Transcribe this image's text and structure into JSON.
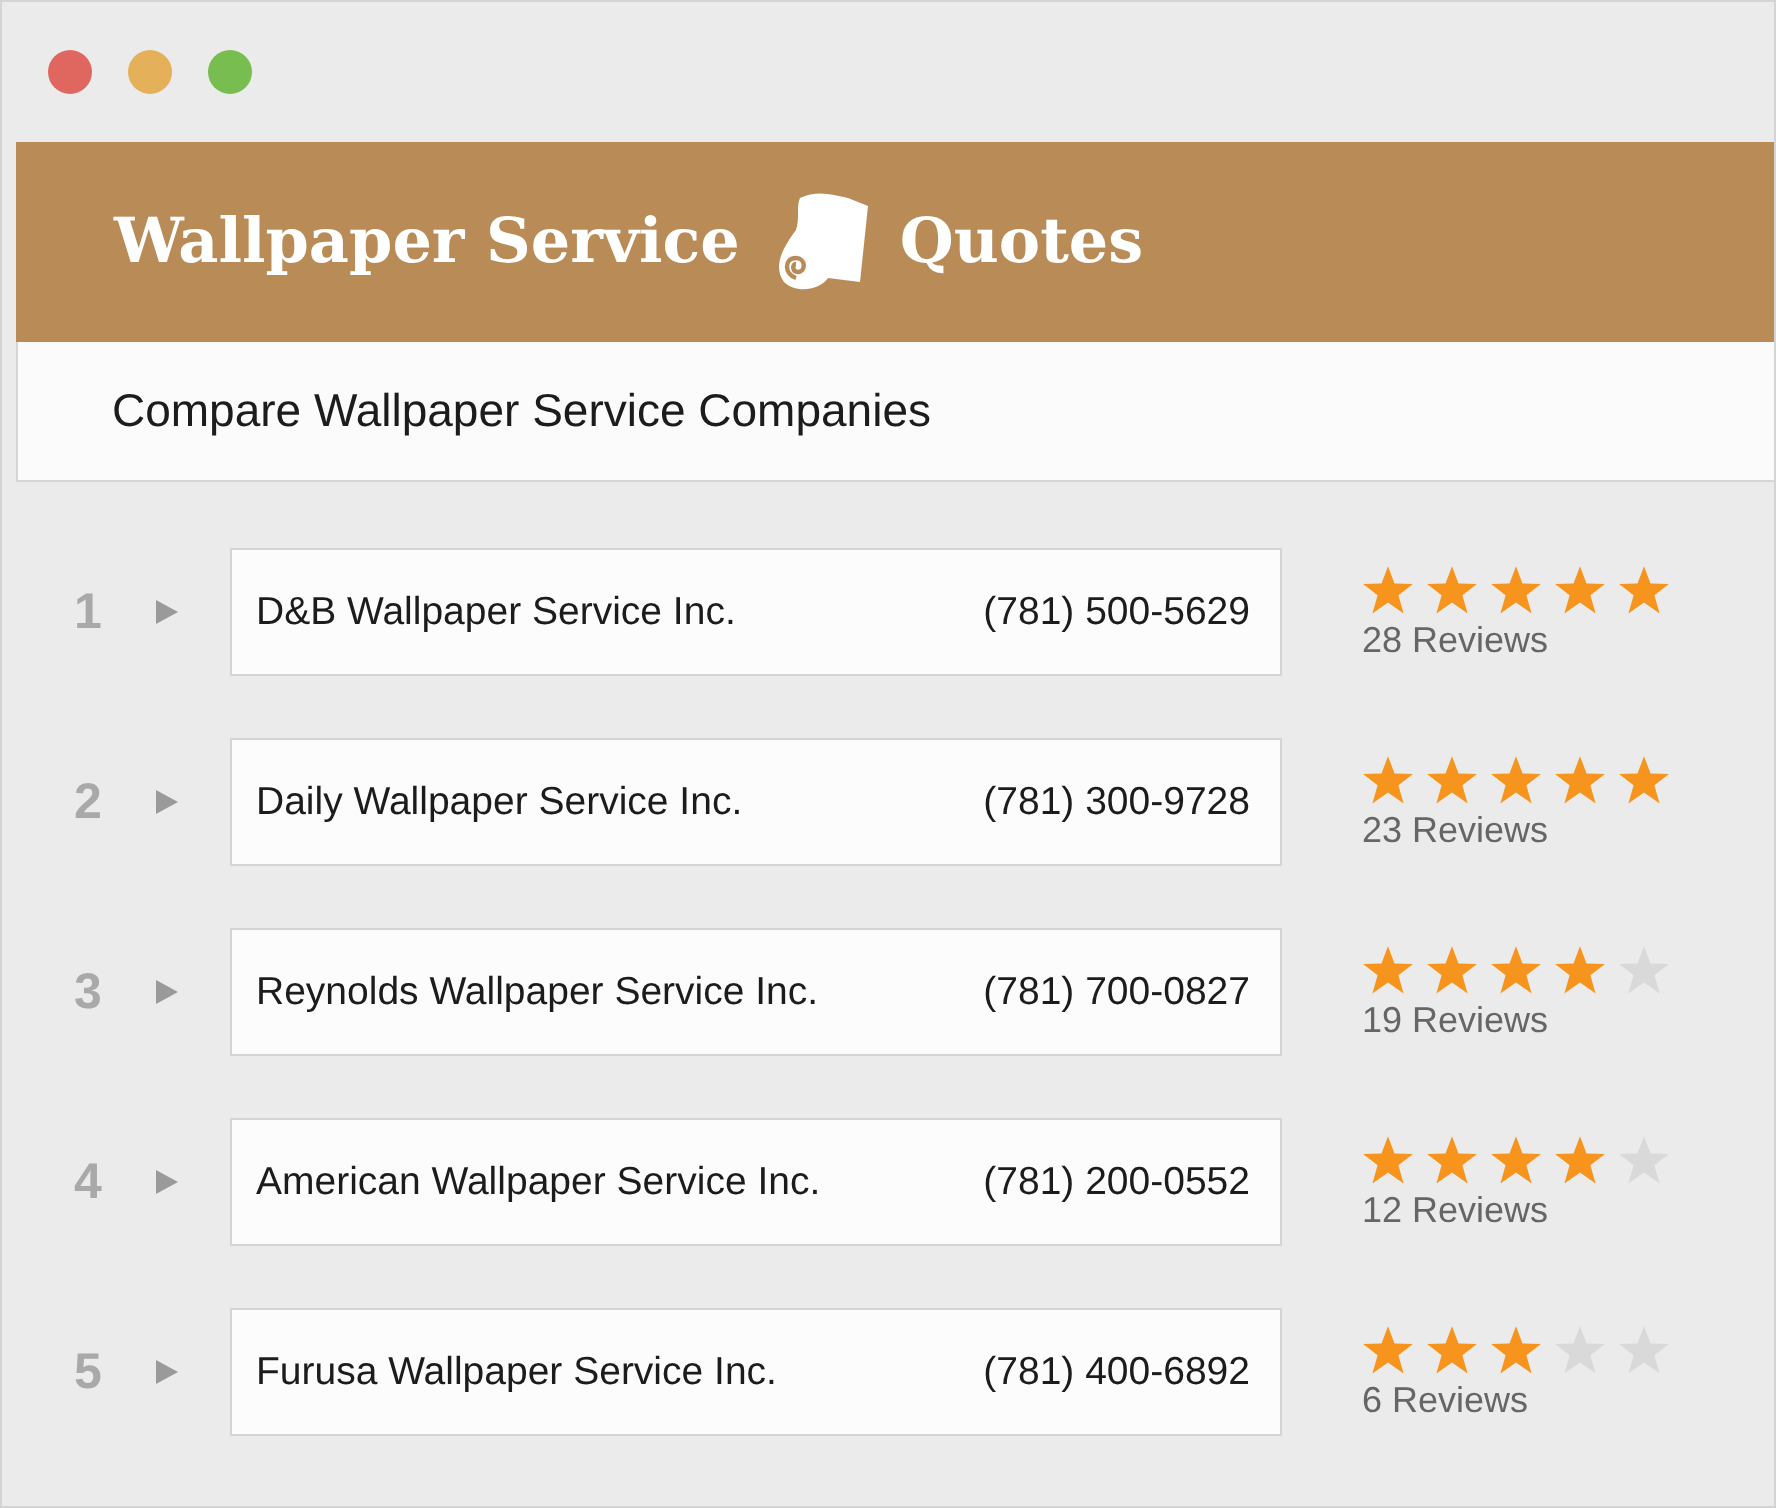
{
  "header": {
    "title_left": "Wallpaper Service",
    "title_right": "Quotes"
  },
  "subtitle": "Compare Wallpaper Service Companies",
  "companies": [
    {
      "rank": "1",
      "name": "D&B Wallpaper Service Inc.",
      "phone": "(781) 500-5629",
      "stars": 5,
      "reviews": "28 Reviews"
    },
    {
      "rank": "2",
      "name": "Daily Wallpaper Service Inc.",
      "phone": "(781) 300-9728",
      "stars": 5,
      "reviews": "23 Reviews"
    },
    {
      "rank": "3",
      "name": "Reynolds Wallpaper Service Inc.",
      "phone": "(781) 700-0827",
      "stars": 4,
      "reviews": "19 Reviews"
    },
    {
      "rank": "4",
      "name": "American Wallpaper Service Inc.",
      "phone": "(781) 200-0552",
      "stars": 4,
      "reviews": "12 Reviews"
    },
    {
      "rank": "5",
      "name": "Furusa Wallpaper Service Inc.",
      "phone": "(781) 400-6892",
      "stars": 3,
      "reviews": "6 Reviews"
    }
  ]
}
